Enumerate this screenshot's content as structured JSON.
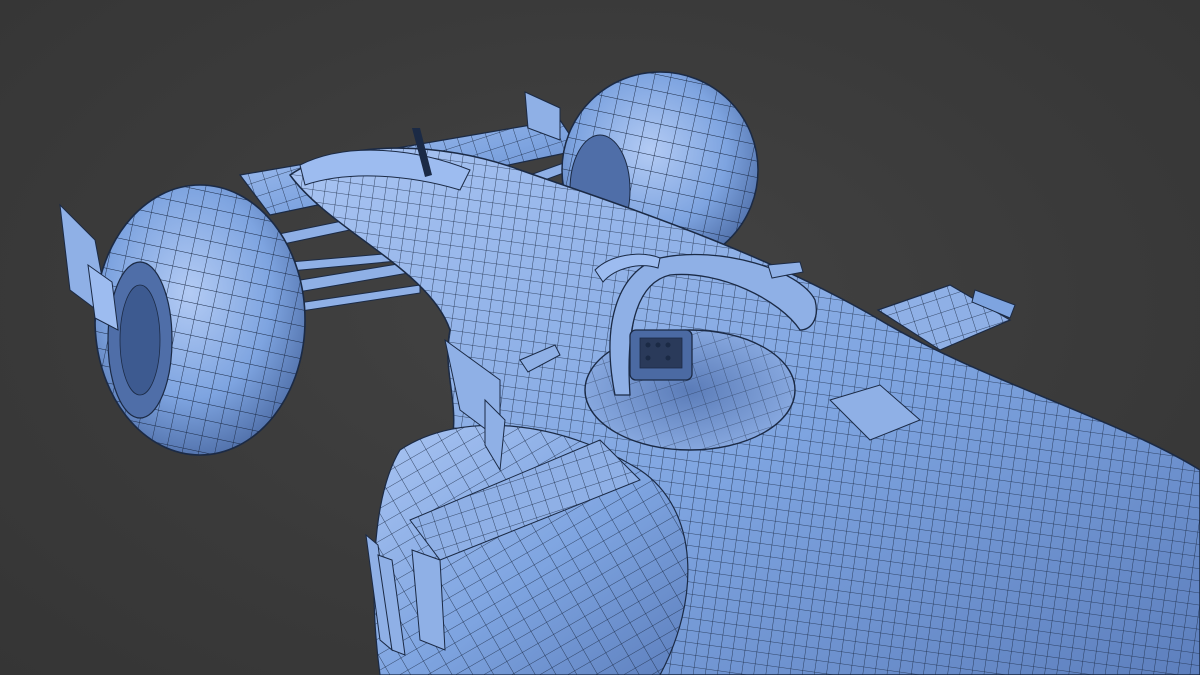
{
  "viewport": {
    "background_color": "#3b3b3b",
    "mesh_fill_color": "#7ea4e0",
    "mesh_light_color": "#a9c4f2",
    "mesh_shadow_color": "#4b6aa3",
    "wire_color": "#1b2a45",
    "render_mode": "wireframe-on-shaded"
  }
}
